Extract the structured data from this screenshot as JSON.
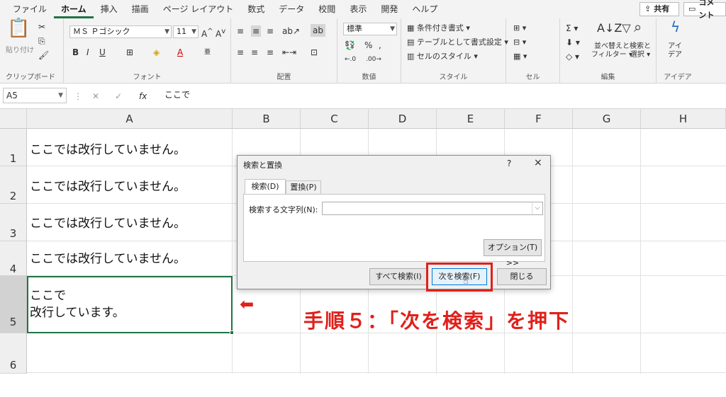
{
  "ribbon_tabs": [
    "ファイル",
    "ホーム",
    "挿入",
    "描画",
    "ページ レイアウト",
    "数式",
    "データ",
    "校閲",
    "表示",
    "開発",
    "ヘルプ"
  ],
  "active_tab": "ホーム",
  "share_label": "共有",
  "comment_label": "コメント",
  "groups": {
    "clipboard": "クリップボード",
    "font": "フォント",
    "alignment": "配置",
    "number": "数値",
    "style": "スタイル",
    "cells": "セル",
    "editing": "編集",
    "ideas": "アイデア"
  },
  "clipboard": {
    "paste": "貼り付け"
  },
  "font": {
    "name": "ＭＳ Ｐゴシック",
    "size": "11",
    "bold": "B",
    "italic": "I",
    "underline": "U"
  },
  "number": {
    "format": "標準"
  },
  "style": {
    "conditional": "条件付き書式",
    "table": "テーブルとして書式設定",
    "cell_style": "セルのスタイル"
  },
  "cells": {
    "A1": "ここでは改行していません。",
    "A2": "ここでは改行していません。",
    "A3": "ここでは改行していません。",
    "A4": "ここでは改行していません。",
    "A5_line1": "ここで",
    "A5_line2": "改行しています。"
  },
  "editing": {
    "sort": "並べ替えと",
    "sort2": "フィルター",
    "find": "検索と",
    "find2": "選択"
  },
  "ideas": {
    "label1": "アイ",
    "label2": "デア"
  },
  "formula_bar": {
    "name_box": "A5",
    "fx": "fx",
    "content": "ここで"
  },
  "columns": [
    "A",
    "B",
    "C",
    "D",
    "E",
    "F",
    "G",
    "H"
  ],
  "rows": [
    "1",
    "2",
    "3",
    "4",
    "5",
    "6"
  ],
  "dialog": {
    "title": "検索と置換",
    "help": "?",
    "close": "×",
    "tab_find": "検索(D)",
    "tab_replace": "置換(P)",
    "find_label": "検索する文字列(N):",
    "find_value": "",
    "options_button": "オプション(T) >>",
    "find_all_button": "すべて検索(I)",
    "find_next_button": "次を検索(F)",
    "close_button": "閉じる"
  },
  "annotation": {
    "arrow": "⬅",
    "text": "手順５：「次を検索」を押下"
  },
  "colors": {
    "accent": "#217346",
    "annotation_red": "#e0201b"
  }
}
